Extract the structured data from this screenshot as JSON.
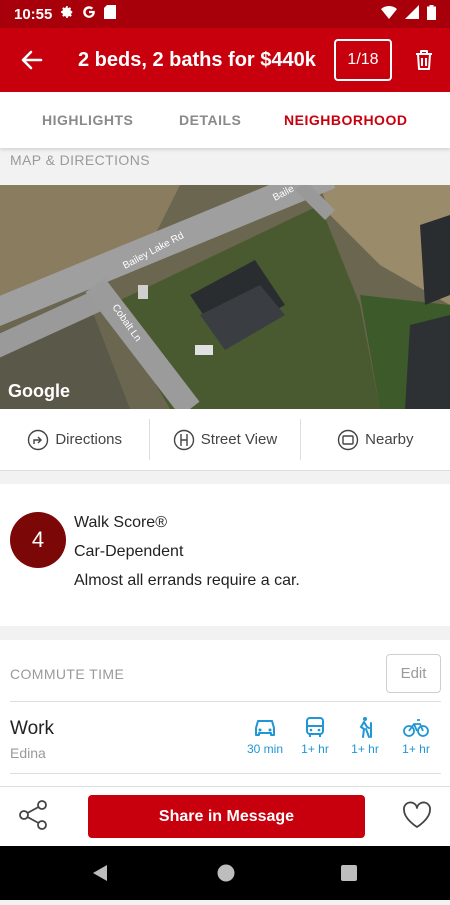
{
  "status": {
    "time": "10:55"
  },
  "header": {
    "title": "2 beds, 2 baths for $440k",
    "counter": "1/18"
  },
  "tabs": [
    {
      "label": "HIGHLIGHTS"
    },
    {
      "label": "DETAILS"
    },
    {
      "label": "NEIGHBORHOOD"
    }
  ],
  "map_section": {
    "label": "MAP & DIRECTIONS",
    "google": "Google",
    "streets": [
      "Bailey Lake Rd",
      "Cobalt Ln",
      "Baile"
    ]
  },
  "map_actions": [
    {
      "label": "Directions",
      "icon": "directions-icon"
    },
    {
      "label": "Street View",
      "icon": "street-view-icon"
    },
    {
      "label": "Nearby",
      "icon": "nearby-icon"
    }
  ],
  "walk_score": {
    "score": "4",
    "title": "Walk Score®",
    "category": "Car-Dependent",
    "description": "Almost all errands require a car."
  },
  "commute": {
    "label": "COMMUTE TIME",
    "edit": "Edit",
    "destination": "Work",
    "destination_sub": "Edina",
    "modes": [
      {
        "icon": "car-icon",
        "time": "30 min"
      },
      {
        "icon": "bus-icon",
        "time": "1+ hr"
      },
      {
        "icon": "walk-icon",
        "time": "1+ hr"
      },
      {
        "icon": "bike-icon",
        "time": "1+ hr"
      }
    ]
  },
  "bottom": {
    "share_message": "Share in Message"
  },
  "colors": {
    "brand": "#c8000d",
    "status_bar": "#a8000b",
    "walk_score": "#7b0707",
    "accent": "#2196d6"
  }
}
